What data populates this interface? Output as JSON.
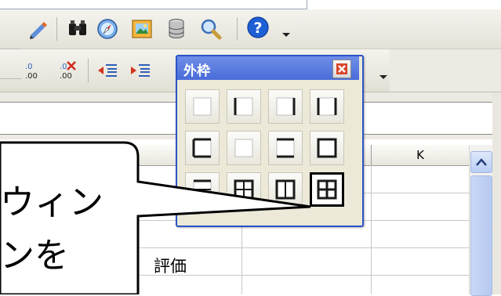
{
  "sheet": {
    "column_label": "K",
    "cell_text": "評価"
  },
  "palette": {
    "title": "外枠",
    "close_icon": "close-icon",
    "options": [
      {
        "name": "no-border"
      },
      {
        "name": "left-border"
      },
      {
        "name": "right-border"
      },
      {
        "name": "left-right-border"
      },
      {
        "name": "top-bottom-border"
      },
      {
        "name": "light-border"
      },
      {
        "name": "box-border-no-inner"
      },
      {
        "name": "box-border"
      },
      {
        "name": "box-inner-horizontal"
      },
      {
        "name": "all-borders"
      },
      {
        "name": "box-inner-vertical"
      },
      {
        "name": "all-borders-selected"
      }
    ],
    "selected_index": 11
  },
  "callout": {
    "line1": "ウィン",
    "line2": "ンを"
  },
  "toolbar": {
    "icons": [
      "edit-icon",
      "binoculars-icon",
      "navigator-icon",
      "gallery-icon",
      "database-icon",
      "zoom-icon",
      "help-icon"
    ],
    "format_icons": [
      "number-format-decimal-icon",
      "delete-decimal-icon",
      "decrease-indent-icon",
      "increase-indent-icon"
    ]
  },
  "colors": {
    "palette_title": "#4a6cd9",
    "palette_border": "#2b54c6",
    "help_icon": "#1f5fd6"
  }
}
